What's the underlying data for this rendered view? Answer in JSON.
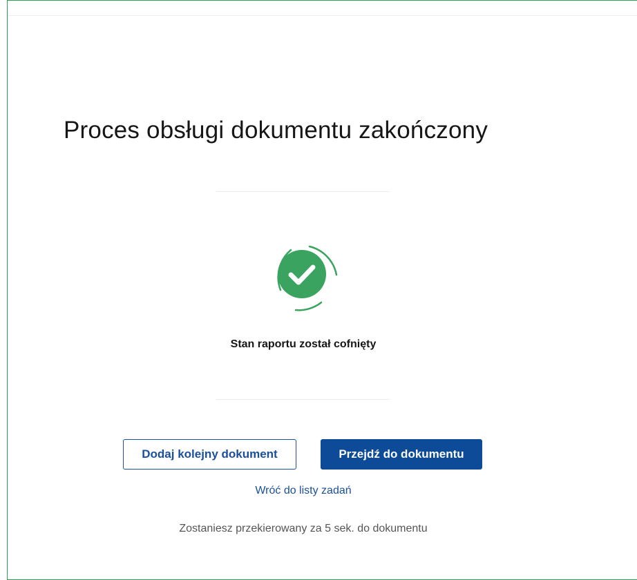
{
  "page": {
    "title": "Proces obsługi dokumentu zakończony",
    "status_message": "Stan raportu został cofnięty",
    "redirect_note": "Zostaniesz przekierowany za 5 sek. do dokumentu"
  },
  "actions": {
    "add_next_label": "Dodaj kolejny dokument",
    "go_to_document_label": "Przejdź do dokumentu",
    "back_to_tasks_label": "Wróć do listy zadań"
  },
  "icons": {
    "status": "check-circle-icon"
  },
  "colors": {
    "success": "#3aa35f",
    "primary": "#0d4b98",
    "frame_border": "#2e9e4f"
  }
}
